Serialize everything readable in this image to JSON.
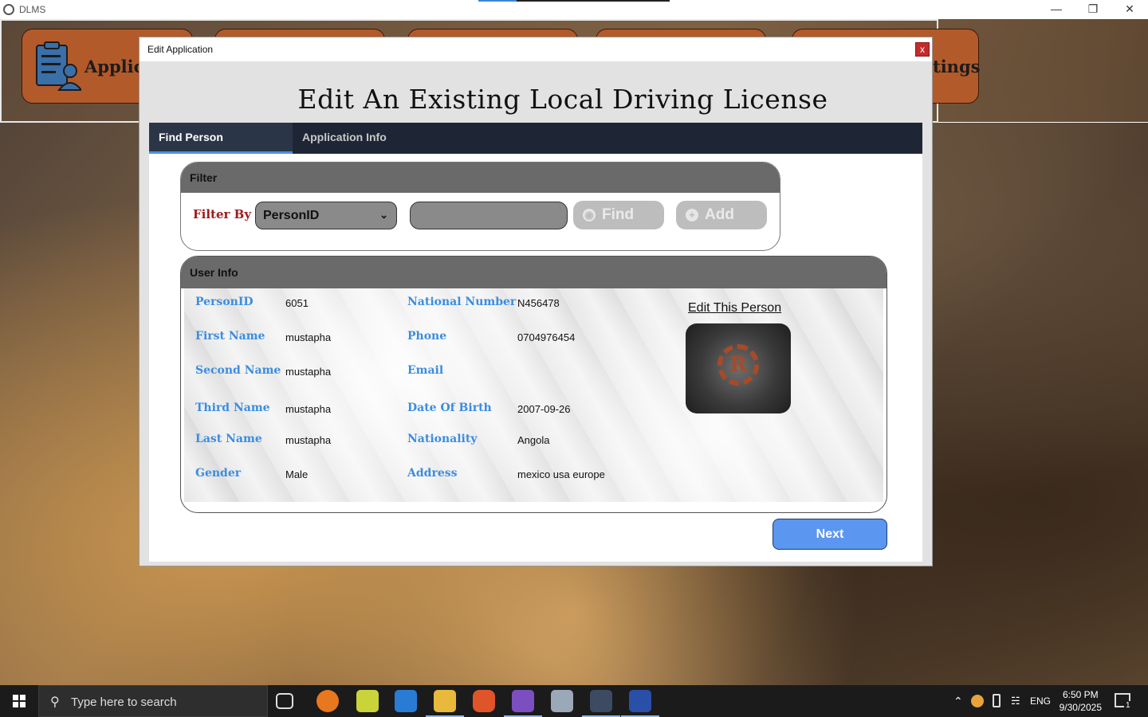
{
  "window": {
    "title": "DLMS",
    "controls": [
      "—",
      "❐",
      "✕"
    ]
  },
  "main_menu": {
    "items": [
      {
        "label": "Applica"
      },
      {
        "label": "tings"
      }
    ]
  },
  "dialog": {
    "title": "Edit Application",
    "close_label": "x",
    "heading": "Edit An Existing Local Driving License",
    "tabs": [
      {
        "label": "Find Person"
      },
      {
        "label": "Application Info"
      }
    ],
    "filter": {
      "group_title": "Filter",
      "label": "Filter By",
      "selected_option": "PersonID",
      "input_value": "",
      "find_label": "Find",
      "add_label": "Add"
    },
    "user_info": {
      "group_title": "User Info",
      "edit_link": "Edit This Person",
      "fields": {
        "person_id": {
          "label": "PersonID",
          "value": "6051"
        },
        "first_name": {
          "label": "First Name",
          "value": "mustapha"
        },
        "second_name": {
          "label": "Second Name",
          "value": "mustapha"
        },
        "third_name": {
          "label": "Third Name",
          "value": "mustapha"
        },
        "last_name": {
          "label": "Last Name",
          "value": "mustapha"
        },
        "gender": {
          "label": "Gender",
          "value": "Male"
        },
        "national_number": {
          "label": "National Number",
          "value": "N456478"
        },
        "phone": {
          "label": "Phone",
          "value": "0704976454"
        },
        "email": {
          "label": "Email",
          "value": ""
        },
        "date_of_birth": {
          "label": "Date Of Birth",
          "value": "2007-09-26"
        },
        "nationality": {
          "label": "Nationality",
          "value": "Angola"
        },
        "address": {
          "label": "Address",
          "value": "mexico usa europe"
        }
      }
    },
    "next_label": "Next"
  },
  "taskbar": {
    "search_placeholder": "Type here to search",
    "language": "ENG",
    "time": "6:50 PM",
    "date": "9/30/2025",
    "notification_count": "1"
  },
  "colors": {
    "label_blue": "#3a8de0",
    "filter_red": "#9b1c1c",
    "tab_bar": "#1e2636",
    "next_button": "#5b96f0",
    "menu_button": "#b35a2a"
  }
}
